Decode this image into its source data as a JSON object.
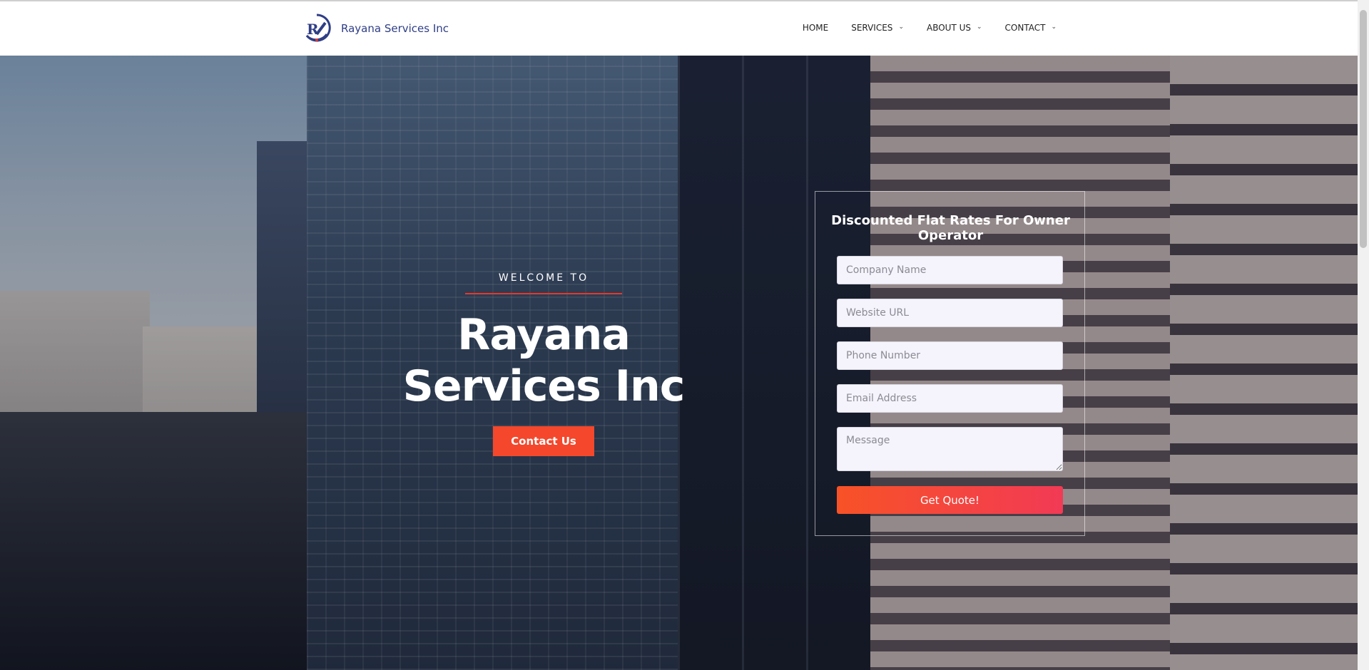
{
  "header": {
    "brand_name": "Rayana Services Inc",
    "logo_icon": "rs-logo-icon",
    "nav": [
      {
        "label": "HOME",
        "has_dropdown": false
      },
      {
        "label": "SERVICES",
        "has_dropdown": true
      },
      {
        "label": "ABOUT US",
        "has_dropdown": true
      },
      {
        "label": "CONTACT",
        "has_dropdown": true
      }
    ]
  },
  "hero": {
    "welcome": "WELCOME TO",
    "title_line1": "Rayana",
    "title_line2": "Services Inc",
    "contact_button": "Contact Us"
  },
  "form": {
    "title": "Discounted Flat Rates For Owner Operator",
    "company_placeholder": "Company Name",
    "website_placeholder": "Website URL",
    "phone_placeholder": "Phone Number",
    "email_placeholder": "Email Address",
    "message_placeholder": "Message",
    "submit_label": "Get Quote!"
  },
  "colors": {
    "accent": "#f4472b",
    "brand_blue": "#2f3e86"
  }
}
